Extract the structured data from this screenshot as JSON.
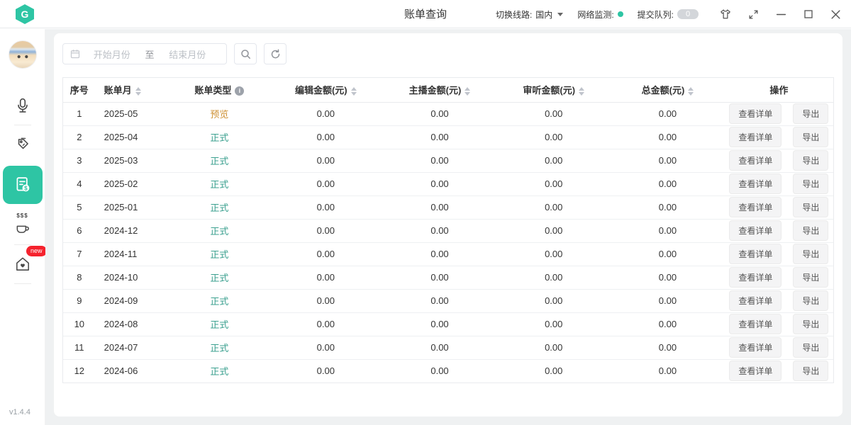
{
  "window": {
    "title": "账单查询",
    "logo_letter": "G",
    "version": "v1.4.4",
    "topbar": {
      "line_label": "切换线路:",
      "line_value": "国内",
      "network_label": "网络监测:",
      "queue_label": "提交队列:",
      "queue_count": "0"
    }
  },
  "colors": {
    "accent": "#2ec5a4",
    "network_dot": "#2ec5a4",
    "preview_text": "#cf9236",
    "formal_text": "#3ba08f",
    "badge_red": "#f5222d"
  },
  "sidebar": {
    "badge": "new",
    "coffee_steam": "$$$",
    "items": [
      {
        "icon": "microphone-icon",
        "active": false
      },
      {
        "icon": "price-tags-icon",
        "active": false
      },
      {
        "icon": "billing-document-icon",
        "active": true
      },
      {
        "icon": "coffee-cup-icon",
        "active": false
      },
      {
        "icon": "home-heart-icon",
        "active": false,
        "badge": "new"
      }
    ]
  },
  "filters": {
    "start_placeholder": "开始月份",
    "range_separator": "至",
    "end_placeholder": "结束月份"
  },
  "table": {
    "headers": [
      {
        "label": "序号",
        "sort": false,
        "info": false
      },
      {
        "label": "账单月",
        "sort": true,
        "info": false
      },
      {
        "label": "账单类型",
        "sort": false,
        "info": true
      },
      {
        "label": "编辑金额(元)",
        "sort": true,
        "info": false
      },
      {
        "label": "主播金额(元)",
        "sort": true,
        "info": false
      },
      {
        "label": "审听金额(元)",
        "sort": true,
        "info": false
      },
      {
        "label": "总金额(元)",
        "sort": true,
        "info": false
      },
      {
        "label": "操作",
        "sort": false,
        "info": false
      }
    ],
    "actions": {
      "view": "查看详单",
      "export": "导出"
    },
    "rows": [
      {
        "index": "1",
        "month": "2025-05",
        "type": "预览",
        "type_kind": "preview",
        "edit_amount": "0.00",
        "anchor_amount": "0.00",
        "audit_amount": "0.00",
        "total_amount": "0.00"
      },
      {
        "index": "2",
        "month": "2025-04",
        "type": "正式",
        "type_kind": "formal",
        "edit_amount": "0.00",
        "anchor_amount": "0.00",
        "audit_amount": "0.00",
        "total_amount": "0.00"
      },
      {
        "index": "3",
        "month": "2025-03",
        "type": "正式",
        "type_kind": "formal",
        "edit_amount": "0.00",
        "anchor_amount": "0.00",
        "audit_amount": "0.00",
        "total_amount": "0.00"
      },
      {
        "index": "4",
        "month": "2025-02",
        "type": "正式",
        "type_kind": "formal",
        "edit_amount": "0.00",
        "anchor_amount": "0.00",
        "audit_amount": "0.00",
        "total_amount": "0.00"
      },
      {
        "index": "5",
        "month": "2025-01",
        "type": "正式",
        "type_kind": "formal",
        "edit_amount": "0.00",
        "anchor_amount": "0.00",
        "audit_amount": "0.00",
        "total_amount": "0.00"
      },
      {
        "index": "6",
        "month": "2024-12",
        "type": "正式",
        "type_kind": "formal",
        "edit_amount": "0.00",
        "anchor_amount": "0.00",
        "audit_amount": "0.00",
        "total_amount": "0.00"
      },
      {
        "index": "7",
        "month": "2024-11",
        "type": "正式",
        "type_kind": "formal",
        "edit_amount": "0.00",
        "anchor_amount": "0.00",
        "audit_amount": "0.00",
        "total_amount": "0.00"
      },
      {
        "index": "8",
        "month": "2024-10",
        "type": "正式",
        "type_kind": "formal",
        "edit_amount": "0.00",
        "anchor_amount": "0.00",
        "audit_amount": "0.00",
        "total_amount": "0.00"
      },
      {
        "index": "9",
        "month": "2024-09",
        "type": "正式",
        "type_kind": "formal",
        "edit_amount": "0.00",
        "anchor_amount": "0.00",
        "audit_amount": "0.00",
        "total_amount": "0.00"
      },
      {
        "index": "10",
        "month": "2024-08",
        "type": "正式",
        "type_kind": "formal",
        "edit_amount": "0.00",
        "anchor_amount": "0.00",
        "audit_amount": "0.00",
        "total_amount": "0.00"
      },
      {
        "index": "11",
        "month": "2024-07",
        "type": "正式",
        "type_kind": "formal",
        "edit_amount": "0.00",
        "anchor_amount": "0.00",
        "audit_amount": "0.00",
        "total_amount": "0.00"
      },
      {
        "index": "12",
        "month": "2024-06",
        "type": "正式",
        "type_kind": "formal",
        "edit_amount": "0.00",
        "anchor_amount": "0.00",
        "audit_amount": "0.00",
        "total_amount": "0.00"
      }
    ]
  }
}
